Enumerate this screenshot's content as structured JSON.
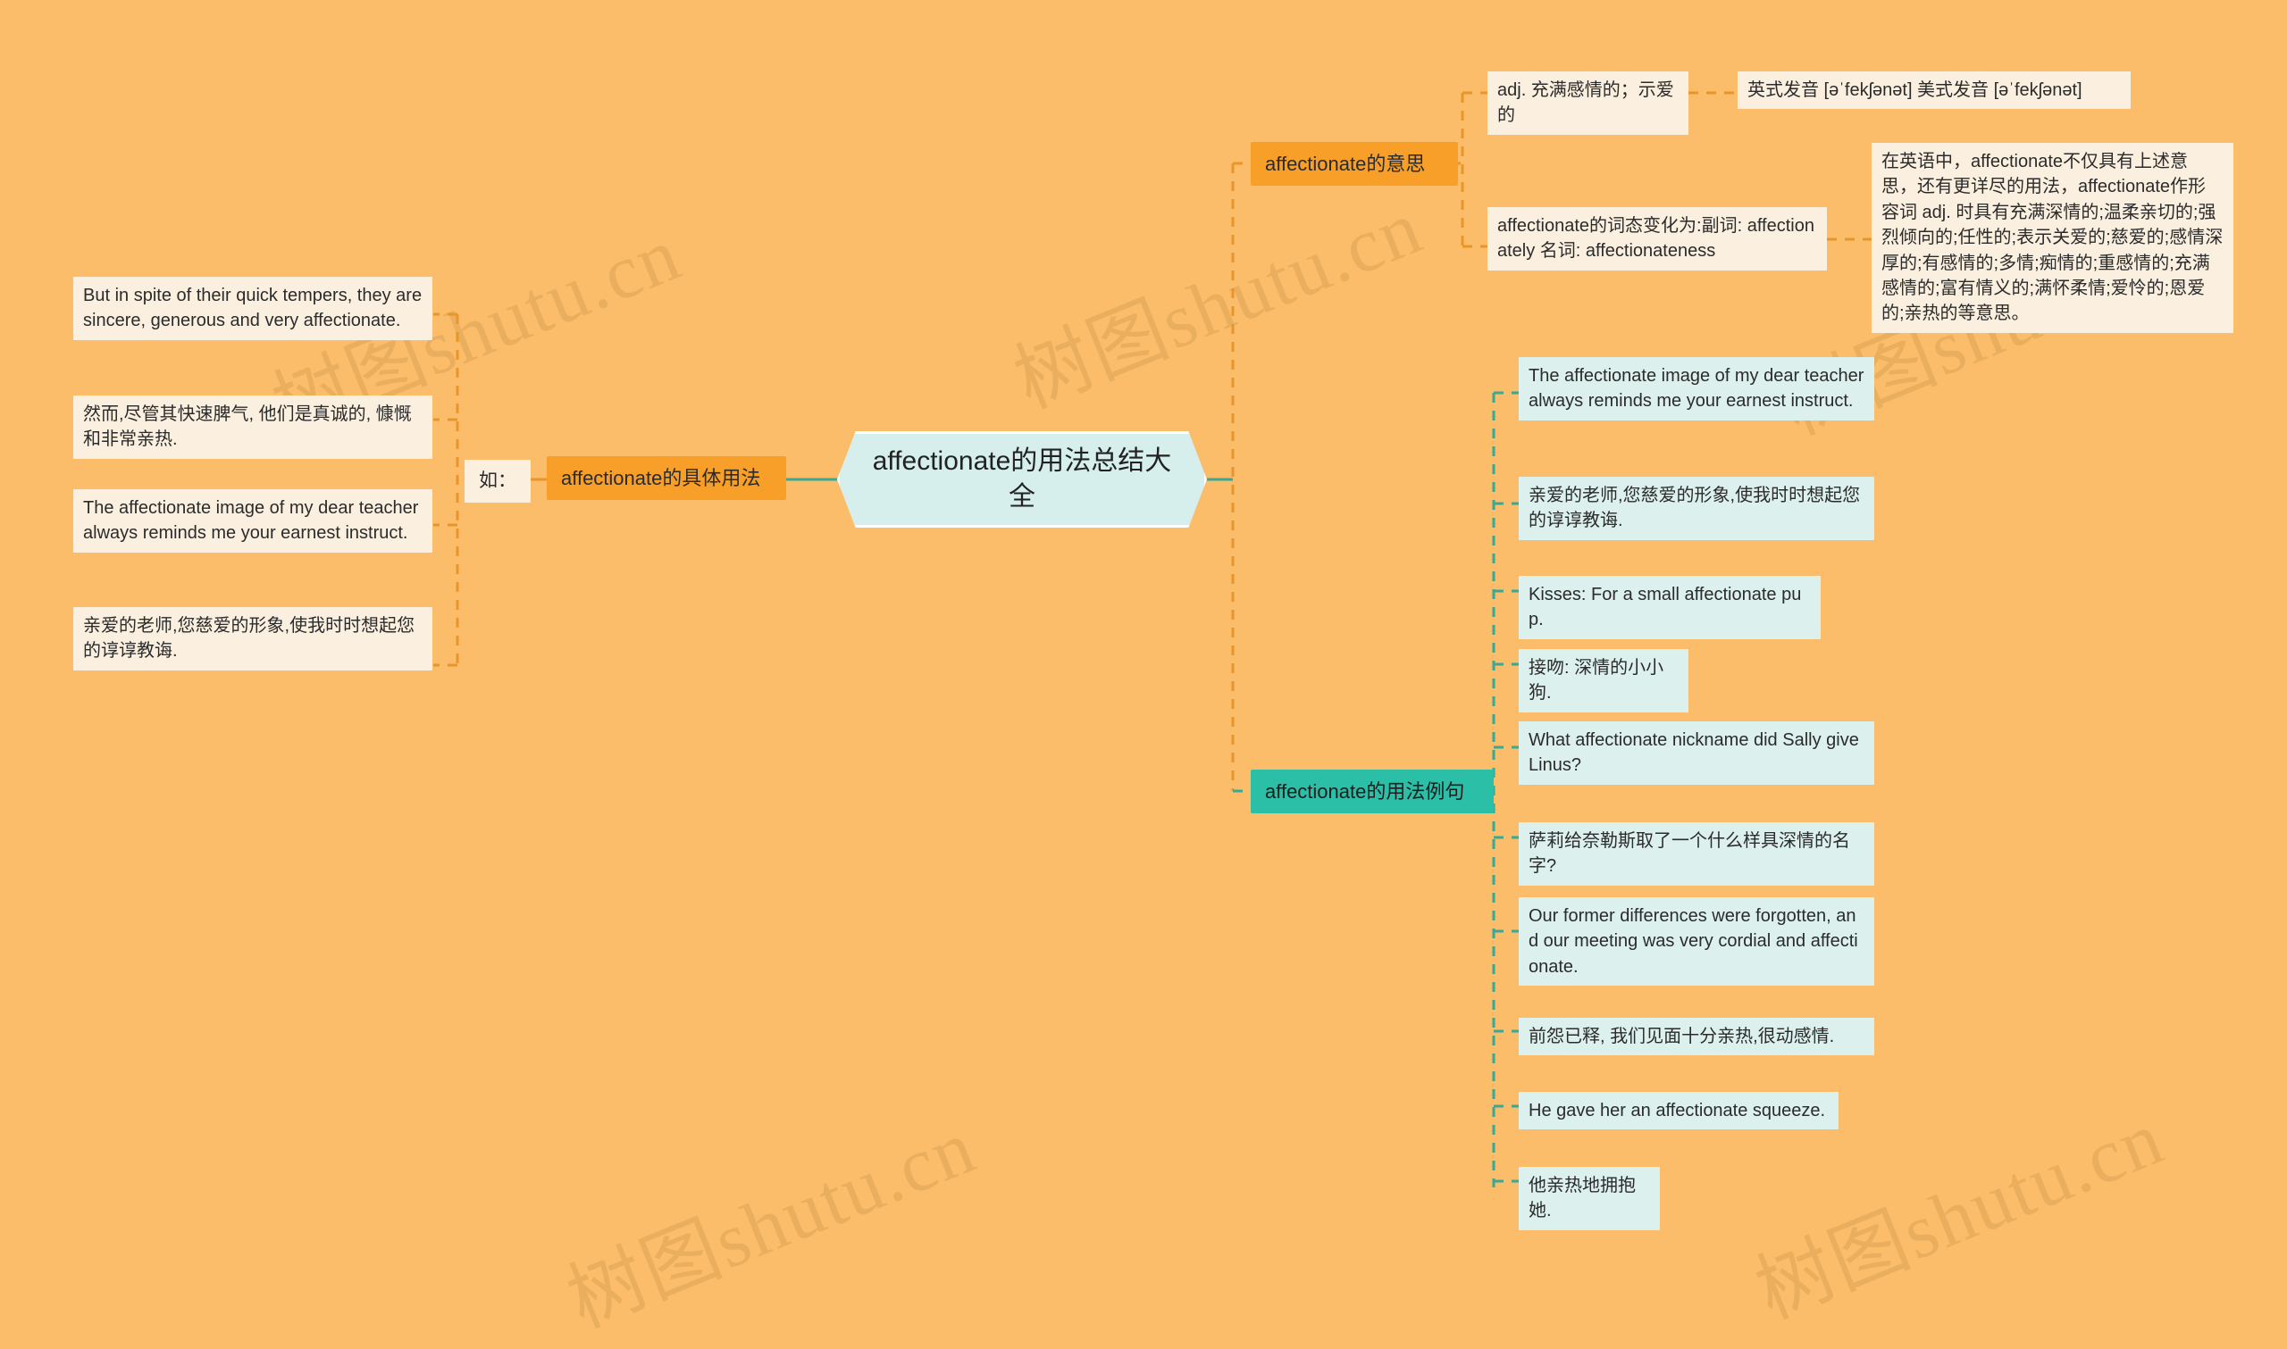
{
  "site": {
    "watermark": "树图shutu.cn"
  },
  "colors": {
    "canvas": "#fbbd69",
    "cream": "#fbf0e0",
    "mint": "#dcf0ee",
    "orange_branch": "#f79f28",
    "teal_branch": "#2bbfa8",
    "root_fill": "#d6efed",
    "orange_wire": "#e8952a",
    "teal_wire": "#3aa893"
  },
  "root": {
    "title": "affectionate的用法总结大全"
  },
  "branches": {
    "left": {
      "chip_label": "如：",
      "label": "affectionate的具体用法",
      "leaves": [
        {
          "text": "But in spite of their quick tempers, they are sincere, generous and very affectionate."
        },
        {
          "text": "然而,尽管其快速脾气, 他们是真诚的, 慷慨和非常亲热."
        },
        {
          "text": "The affectionate image of my dear teacher always reminds me your earnest instruct."
        },
        {
          "text": "亲爱的老师,您慈爱的形象,使我时时想起您的谆谆教诲."
        }
      ]
    },
    "meaning": {
      "label": "affectionate的意思",
      "leaves": [
        {
          "text": "adj. 充满感情的；示爱的",
          "children": [
            {
              "text": "英式发音 [əˈfekʃənət] 美式发音 [əˈfekʃənət]"
            }
          ]
        },
        {
          "text": "affectionate的词态变化为:副词: affectionately 名词: affectionateness",
          "children": [
            {
              "text": "在英语中，affectionate不仅具有上述意思，还有更详尽的用法，affectionate作形容词 adj. 时具有充满深情的;温柔亲切的;强烈倾向的;任性的;表示关爱的;慈爱的;感情深厚的;有感情的;多情;痴情的;重感情的;充满感情的;富有情义的;满怀柔情;爱怜的;恩爱的;亲热的等意思。"
            }
          ]
        }
      ]
    },
    "examples": {
      "label": "affectionate的用法例句",
      "leaves": [
        {
          "text": "The affectionate image of my dear teacher always reminds me your earnest instruct."
        },
        {
          "text": "亲爱的老师,您慈爱的形象,使我时时想起您的谆谆教诲."
        },
        {
          "text": "Kisses: For a small affectionate pup."
        },
        {
          "text": "接吻: 深情的小小狗."
        },
        {
          "text": "What affectionate nickname did Sally give Linus?"
        },
        {
          "text": "萨莉给奈勒斯取了一个什么样具深情的名字?"
        },
        {
          "text": "Our former differences were forgotten, and our meeting was very cordial and affectionate."
        },
        {
          "text": "前怨已释, 我们见面十分亲热,很动感情."
        },
        {
          "text": "He gave her an affectionate squeeze."
        },
        {
          "text": "他亲热地拥抱她."
        }
      ]
    }
  }
}
